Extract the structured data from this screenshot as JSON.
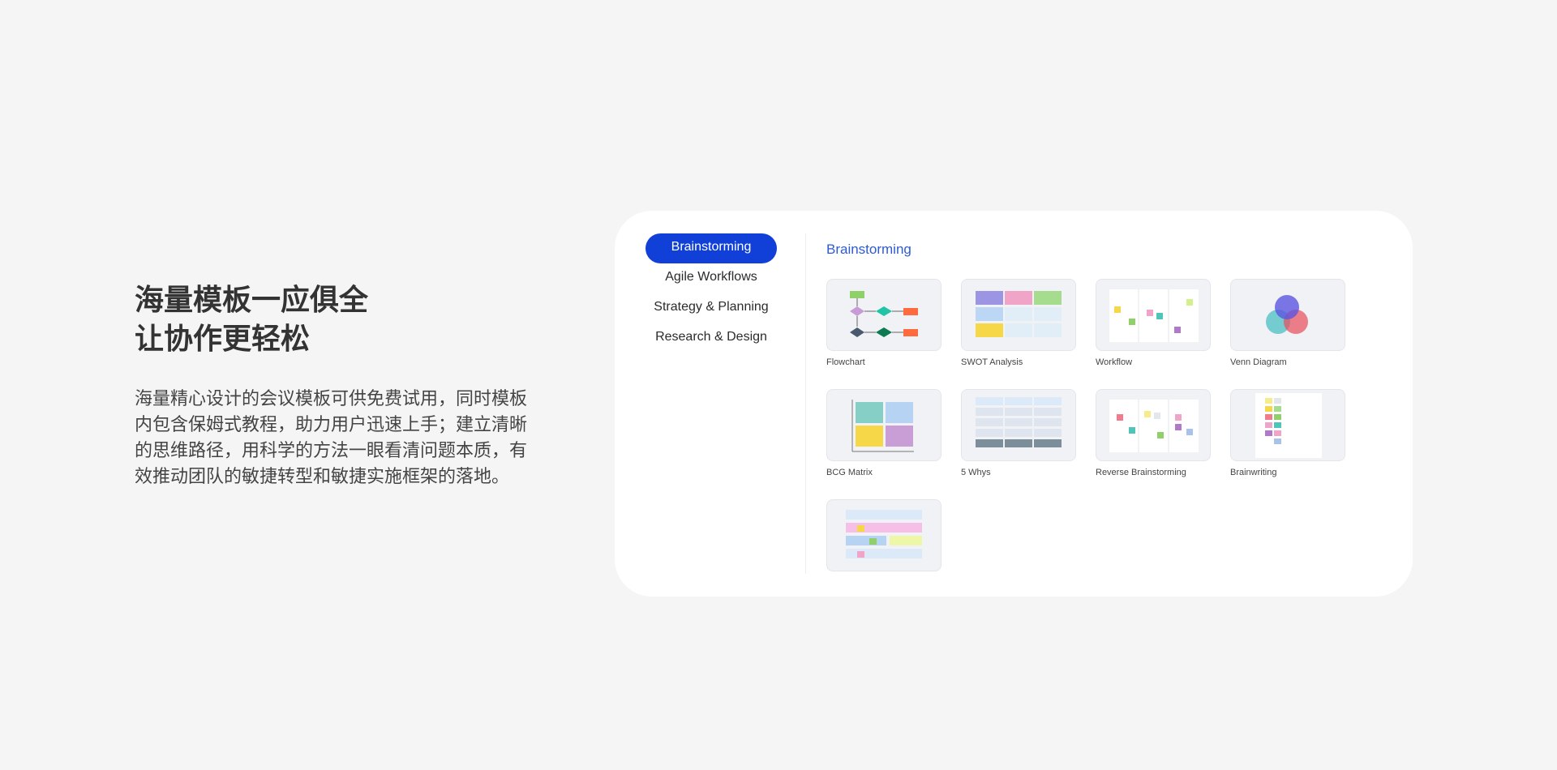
{
  "hero": {
    "title_line1": "海量模板一应俱全",
    "title_line2": "让协作更轻松",
    "description": "海量精心设计的会议模板可供免费试用，同时模板内包含保姆式教程，助力用户迅速上手；建立清晰的思维路径，用科学的方法一眼看清问题本质，有效推动团队的敏捷转型和敏捷实施框架的落地。"
  },
  "sidebar": {
    "items": [
      {
        "label": "Brainstorming",
        "active": true
      },
      {
        "label": "Agile Workflows",
        "active": false
      },
      {
        "label": "Strategy & Planning",
        "active": false
      },
      {
        "label": "Research & Design",
        "active": false
      }
    ]
  },
  "main": {
    "section_title": "Brainstorming",
    "templates": [
      {
        "label": "Flowchart"
      },
      {
        "label": "SWOT Analysis"
      },
      {
        "label": "Workflow"
      },
      {
        "label": "Venn Diagram"
      },
      {
        "label": "BCG Matrix"
      },
      {
        "label": "5 Whys"
      },
      {
        "label": "Reverse Brainstorming"
      },
      {
        "label": "Brainwriting"
      },
      {
        "label": ""
      }
    ]
  },
  "colors": {
    "accent": "#1040d8",
    "section_title": "#2f5bd1",
    "background": "#f5f5f5",
    "card": "#ffffff"
  }
}
